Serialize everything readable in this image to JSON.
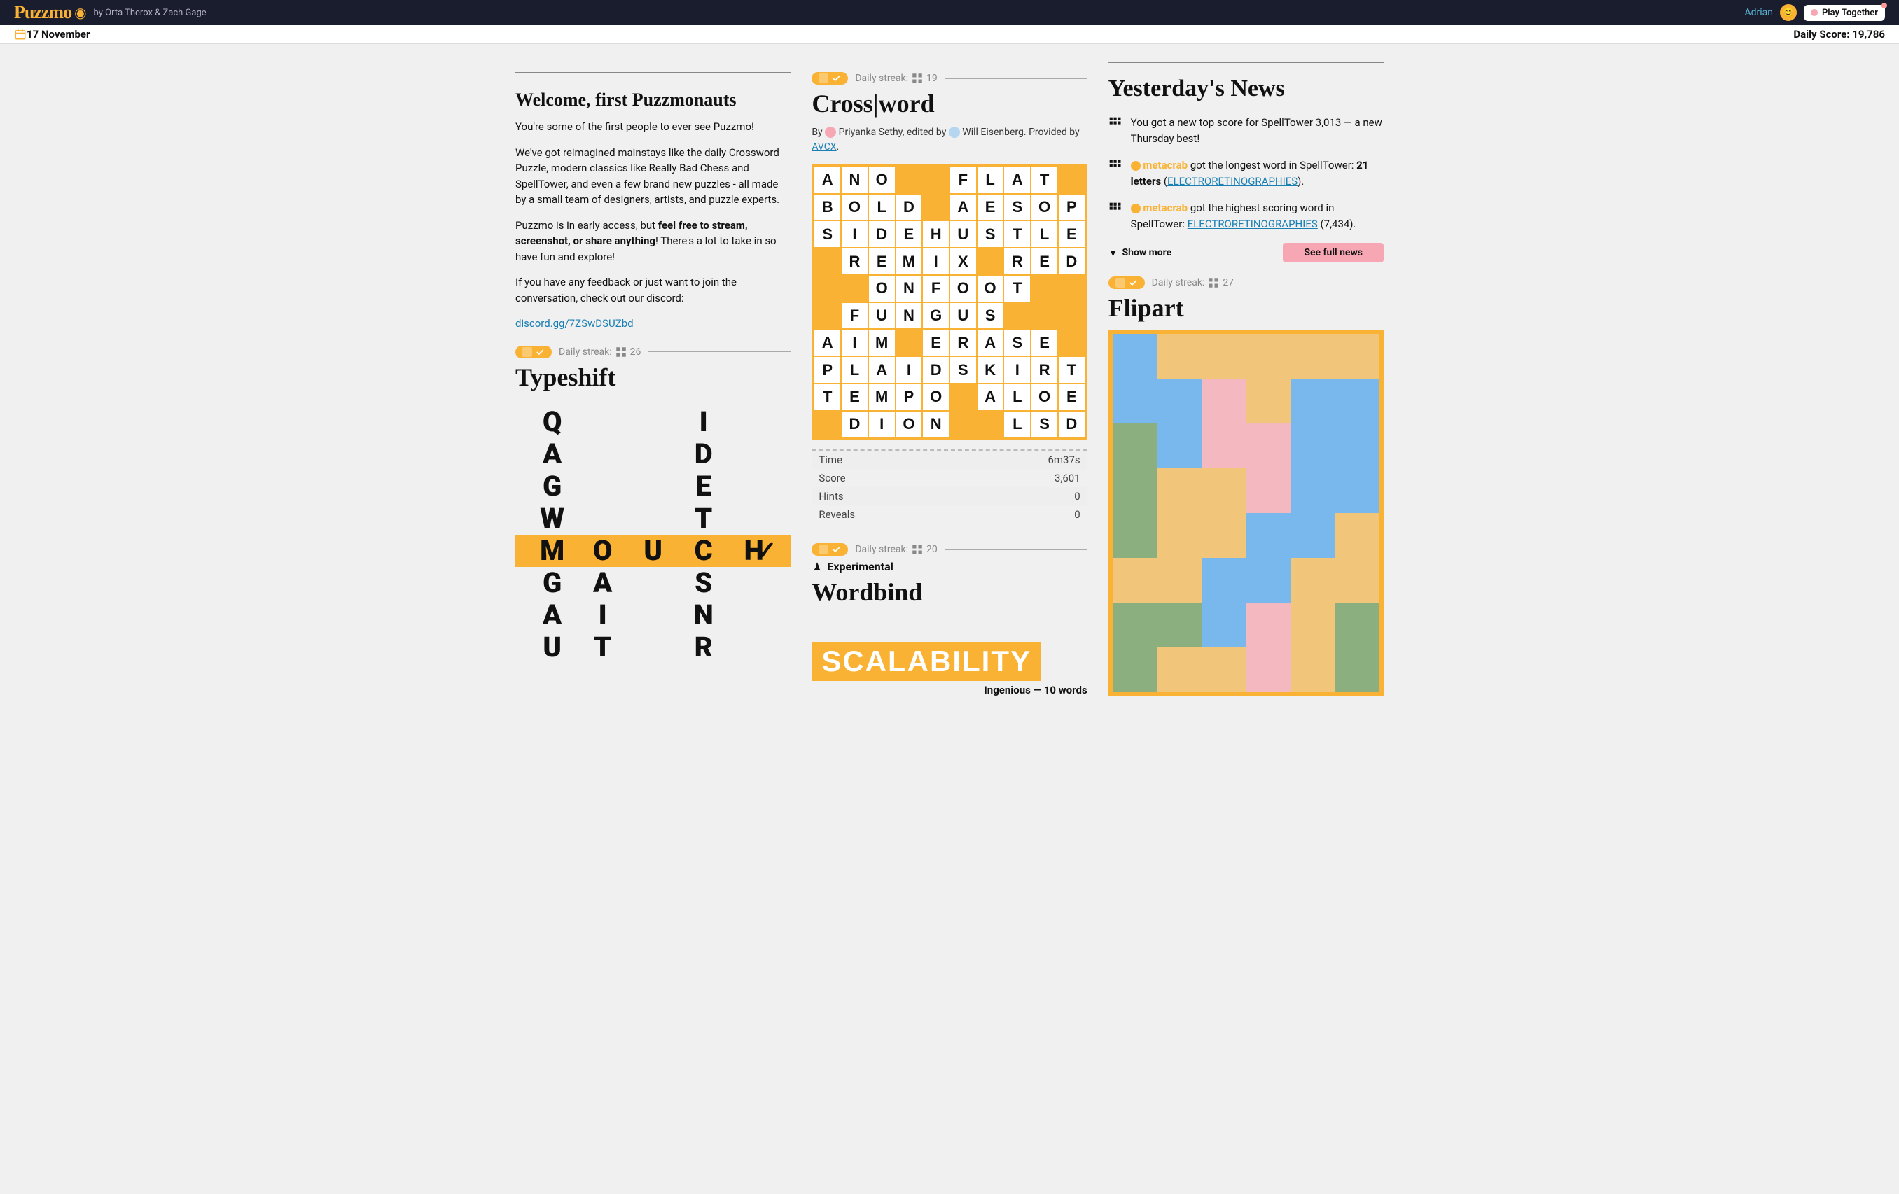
{
  "topbar": {
    "logo": "Puzzmo",
    "byline": "by Orta Therox  & Zach Gage",
    "user": "Adrian",
    "play_together": "Play Together"
  },
  "datebar": {
    "date": "17 November",
    "score_label": "Daily Score: ",
    "score_value": "19,786"
  },
  "welcome": {
    "title": "Welcome, first Puzzmonauts",
    "p1": "You're some of the first people to ever see Puzzmo!",
    "p2": "We've got reimagined mainstays like the daily Crossword Puzzle, modern classics like Really Bad Chess and SpellTower, and even a few brand new puzzles - all made by a small team of designers, artists, and puzzle experts.",
    "p3a": "Puzzmo is in early access, but ",
    "p3b": "feel free to stream, screenshot, or share anything",
    "p3c": "! There's a lot to take in so have fun and explore!",
    "p4": "If you have any feedback or just want to join the conversation, check out our discord:",
    "discord": "discord.gg/7ZSwDSUZbd"
  },
  "typeshift": {
    "streak_label": "Daily streak:",
    "streak_value": "26",
    "title": "Typeshift",
    "columns": [
      [
        "Q",
        "A",
        "G",
        "W",
        "M",
        "G",
        "A",
        "U"
      ],
      [
        "",
        "",
        "",
        "",
        "O",
        "A",
        "I",
        "T"
      ],
      [
        "",
        "",
        "",
        "",
        "U",
        "",
        "",
        ""
      ],
      [
        "I",
        "D",
        "E",
        "T",
        "C",
        "S",
        "N",
        "R"
      ],
      [
        "",
        "",
        "",
        "",
        "H",
        "",
        "",
        ""
      ]
    ],
    "highlight_row": 4
  },
  "crossword": {
    "streak_label": "Daily streak:",
    "streak_value": "19",
    "title": "Cross|word",
    "by_label": "By ",
    "author": "Priyanka Sethy",
    "edited_label": ", edited by ",
    "editor": "Will Eisenberg",
    "provided_label": ". Provided by ",
    "provider": "AVCX",
    "period": ".",
    "grid": [
      [
        "A",
        "N",
        "O",
        "",
        "",
        "F",
        "L",
        "A",
        "T",
        ""
      ],
      [
        "B",
        "O",
        "L",
        "D",
        "",
        "A",
        "E",
        "S",
        "O",
        "P"
      ],
      [
        "S",
        "I",
        "D",
        "E",
        "H",
        "U",
        "S",
        "T",
        "L",
        "E"
      ],
      [
        "",
        "R",
        "E",
        "M",
        "I",
        "X",
        "",
        "R",
        "E",
        "D"
      ],
      [
        "",
        "",
        "O",
        "N",
        "F",
        "O",
        "O",
        "T",
        "",
        ""
      ],
      [
        "",
        "F",
        "U",
        "N",
        "G",
        "U",
        "S",
        "",
        "",
        ""
      ],
      [
        "A",
        "I",
        "M",
        "",
        "E",
        "R",
        "A",
        "S",
        "E",
        ""
      ],
      [
        "P",
        "L",
        "A",
        "I",
        "D",
        "S",
        "K",
        "I",
        "R",
        "T"
      ],
      [
        "T",
        "E",
        "M",
        "P",
        "O",
        "",
        "A",
        "L",
        "O",
        "E"
      ],
      [
        "",
        "D",
        "I",
        "O",
        "N",
        "",
        "",
        "L",
        "S",
        "D"
      ]
    ],
    "stats": [
      {
        "label": "Time",
        "value": "6m37s"
      },
      {
        "label": "Score",
        "value": "3,601"
      },
      {
        "label": "Hints",
        "value": "0"
      },
      {
        "label": "Reveals",
        "value": "0"
      }
    ]
  },
  "wordbind": {
    "streak_label": "Daily streak:",
    "streak_value": "20",
    "experimental": "Experimental",
    "title": "Wordbind",
    "word": "SCALABILITY",
    "sub": "Ingenious — 10 words"
  },
  "news": {
    "title": "Yesterday's News",
    "items": [
      {
        "text": "You got a new top score for SpellTower 3,013 — a new Thursday best!",
        "user": ""
      },
      {
        "pre": "",
        "user": "metacrab",
        "mid": " got the longest word in SpellTower: ",
        "bold": "21 letters",
        "open": " (",
        "link": "ELECTRORETINOGRAPHIES",
        "close": ")."
      },
      {
        "pre": "",
        "user": "metacrab",
        "mid": " got the highest scoring word in SpellTower: ",
        "link": "ELECTRORETINOGRAPHIES",
        "score": " (7,434)."
      }
    ],
    "show_more": "Show more",
    "see_full": "See full news"
  },
  "flipart": {
    "streak_label": "Daily streak:",
    "streak_value": "27",
    "title": "Flipart",
    "cells": [
      "b",
      "o",
      "o",
      "o",
      "o",
      "o",
      "b",
      "b",
      "p",
      "o",
      "b",
      "b",
      "g",
      "b",
      "p",
      "p",
      "b",
      "b",
      "g",
      "o",
      "o",
      "p",
      "b",
      "b",
      "g",
      "o",
      "o",
      "b",
      "b",
      "o",
      "o",
      "o",
      "b",
      "b",
      "o",
      "o",
      "g",
      "g",
      "b",
      "p",
      "o",
      "g",
      "g",
      "o",
      "o",
      "p",
      "o",
      "g"
    ]
  }
}
